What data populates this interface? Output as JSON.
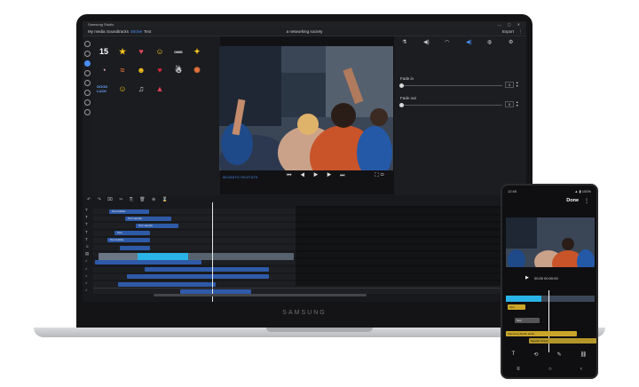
{
  "window": {
    "title": "Samsung Studio"
  },
  "menu": {
    "tabs": [
      "My media",
      "Soundtracks",
      "Sticker",
      "Text"
    ],
    "active_tab": "Sticker",
    "project_title": "a networking society",
    "export_label": "Export",
    "more_label": "⋮"
  },
  "stickers": {
    "items": [
      {
        "label": "15",
        "icon": "calendar-15-sticker",
        "color": "#ffffff"
      },
      {
        "label": "★",
        "icon": "star-sticker",
        "color": "#f4c21d"
      },
      {
        "label": "♥",
        "icon": "heart-sticker",
        "color": "#e0435a"
      },
      {
        "label": "☺",
        "icon": "smile-sticker",
        "color": "#f4c21d"
      },
      {
        "label": "OMG",
        "icon": "omg-sticker",
        "color": "#ffffff"
      },
      {
        "label": "✦",
        "icon": "party-sticker",
        "color": "#f4c21d"
      },
      {
        "label": "◔",
        "icon": "cupcake-sticker",
        "color": "#f0a7c4"
      },
      {
        "label": "≈",
        "icon": "rainbow-sticker",
        "color": "#e3703a"
      },
      {
        "label": "☻",
        "icon": "sunglasses-sticker",
        "color": "#f4c21d"
      },
      {
        "label": "♥",
        "icon": "heart-red-sticker",
        "color": "#d6283a"
      },
      {
        "label": "☃",
        "icon": "ghost-sticker",
        "color": "#ffffff"
      },
      {
        "label": "✺",
        "icon": "sparkle-sticker",
        "color": "#e3703a"
      },
      {
        "label": "GOOD LUCK",
        "icon": "good-luck-sticker",
        "color": "#6aa4ff"
      },
      {
        "label": "☺",
        "icon": "emoji-sticker",
        "color": "#f4c21d"
      },
      {
        "label": "♫",
        "icon": "cat-sticker",
        "color": "#cccccc"
      },
      {
        "label": "▲",
        "icon": "cake-sticker",
        "color": "#e0435a"
      }
    ]
  },
  "preview": {
    "timecode": "00:23:673 / 00:27:673",
    "controls": [
      "⏮",
      "◀",
      "▶",
      "▶",
      "⏭"
    ]
  },
  "properties": {
    "icons": [
      "fx-icon",
      "volume-icon",
      "speed-icon",
      "audio-active-icon",
      "filter-icon",
      "settings-icon"
    ],
    "fade_in": {
      "label": "Fade in",
      "value": "0"
    },
    "fade_out": {
      "label": "Fade out",
      "value": "0"
    }
  },
  "timeline": {
    "tools": "↶ ↷ ⌧ ✂ ⎘ 🗑 ⊕ ⌛",
    "lane_icons": [
      "T",
      "T",
      "T",
      "T",
      "T",
      "☺",
      "▤",
      "♪",
      "♪",
      "♪",
      "♪",
      "♪"
    ],
    "text_clips": [
      "Text bubble",
      "Text sample",
      "Text sample",
      "Text",
      "Text bubble"
    ],
    "audio_label": "Samsung Studio audio"
  },
  "brand": "SAMSUNG",
  "phone": {
    "time": "12:45",
    "status": "▲ ▮ 100%",
    "done_label": "Done",
    "timecode": "00:00 00:00:00",
    "clip_labels": [
      "Text",
      "Text",
      "Samsung Studio audio",
      "Speech to text"
    ],
    "tools": [
      "T",
      "⟲",
      "✎",
      "⛓"
    ],
    "nav": [
      "≡",
      "○",
      "‹"
    ]
  },
  "colors": {
    "accent": "#4b8df8",
    "clip_blue": "#2e5aa8",
    "clip_cyan": "#2ab3e6",
    "clip_yellow": "#caa52a"
  }
}
